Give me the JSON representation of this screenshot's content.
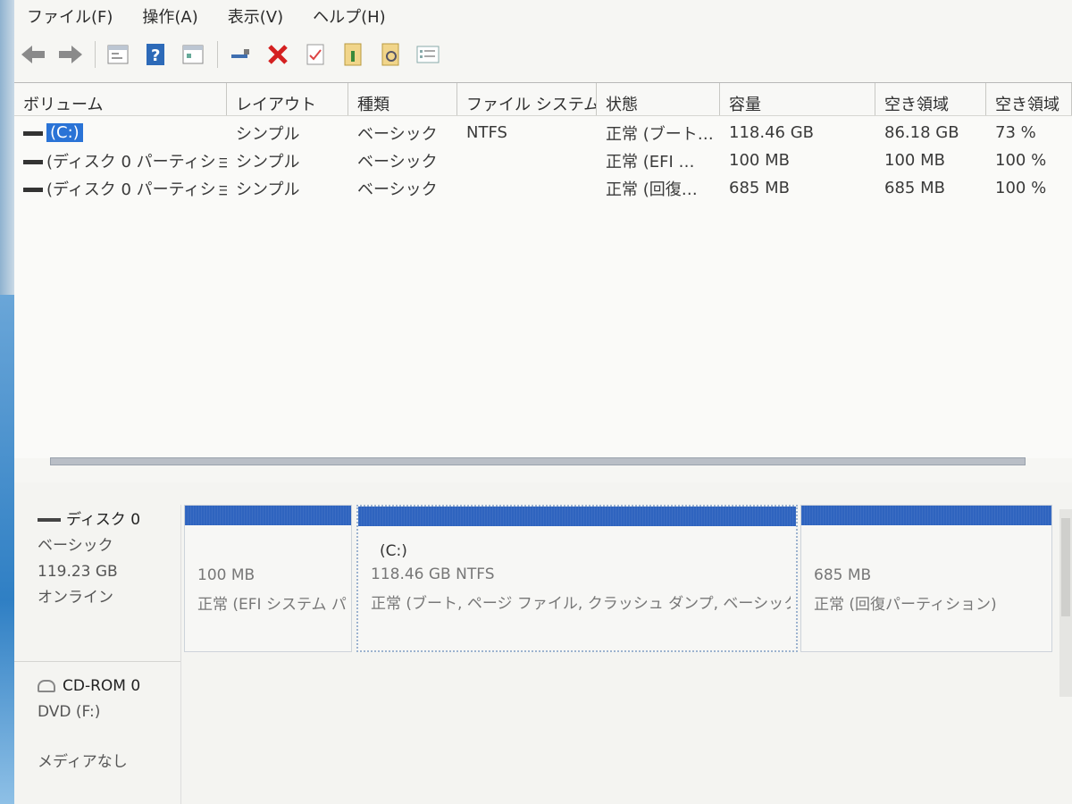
{
  "menu": [
    "ファイル(F)",
    "操作(A)",
    "表示(V)",
    "ヘルプ(H)"
  ],
  "toolbar_icons": [
    "back-arrow-icon",
    "forward-arrow-icon",
    "console-tree-icon",
    "help-icon",
    "properties-icon",
    "connect-icon",
    "delete-icon",
    "check-icon",
    "rescan-icon",
    "search-disk-icon",
    "list-view-icon"
  ],
  "columns": [
    "ボリューム",
    "レイアウト",
    "種類",
    "ファイル システム",
    "状態",
    "容量",
    "空き領域",
    "空き領域"
  ],
  "volumes": [
    {
      "name": "(C:)",
      "layout": "シンプル",
      "type": "ベーシック",
      "fs": "NTFS",
      "status": "正常 (ブート…",
      "capacity": "118.46 GB",
      "free": "86.18 GB",
      "free_pct": "73 %"
    },
    {
      "name": "(ディスク 0 パーティショ…",
      "layout": "シンプル",
      "type": "ベーシック",
      "fs": "",
      "status": "正常 (EFI …",
      "capacity": "100 MB",
      "free": "100 MB",
      "free_pct": "100 %"
    },
    {
      "name": "(ディスク 0 パーティショ…",
      "layout": "シンプル",
      "type": "ベーシック",
      "fs": "",
      "status": "正常 (回復…",
      "capacity": "685 MB",
      "free": "685 MB",
      "free_pct": "100 %"
    }
  ],
  "disk0": {
    "name": "ディスク 0",
    "type": "ベーシック",
    "size": "119.23 GB",
    "state": "オンライン",
    "partitions": [
      {
        "label": "",
        "size": "100 MB",
        "status": "正常 (EFI システム パ"
      },
      {
        "label": "(C:)",
        "size": "118.46 GB NTFS",
        "status": "正常 (ブート, ページ ファイル, クラッシュ ダンプ, ベーシック デー"
      },
      {
        "label": "",
        "size": "685 MB",
        "status": "正常 (回復パーティション)"
      }
    ]
  },
  "cdrom": {
    "name": "CD-ROM 0",
    "drive": "DVD (F:)",
    "media": "メディアなし"
  },
  "colors": {
    "partition_bar": "#2f64bf",
    "selection": "#2a73d6"
  }
}
